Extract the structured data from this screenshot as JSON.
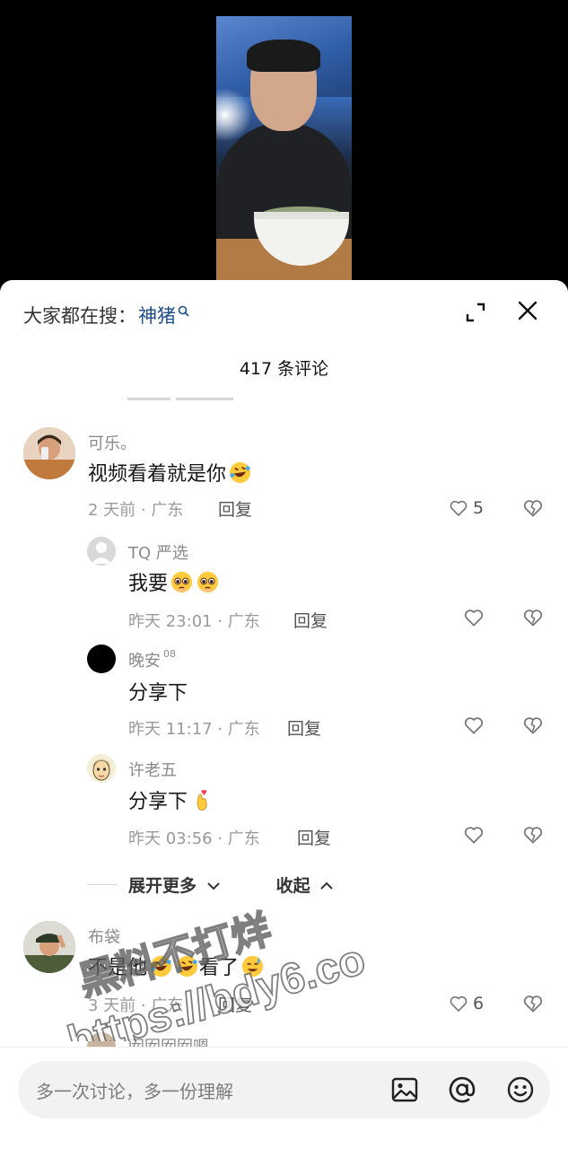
{
  "header": {
    "search_prefix": "大家都在搜：",
    "search_term": "神猪",
    "comment_count": "417 条评论"
  },
  "comments": [
    {
      "name": "可乐。",
      "text": "视频看着就是你",
      "meta": "2 天前 · 广东",
      "reply_label": "回复",
      "likes": "5",
      "emojis": [
        "rofl-emoji"
      ]
    },
    {
      "name": "TQ 严选",
      "text": "我要",
      "meta": "昨天 23:01 · 广东",
      "reply_label": "回复",
      "emojis": [
        "pleading-emoji",
        "pleading-emoji"
      ]
    },
    {
      "name": "晚安",
      "name_badge": "08",
      "text": "分享下",
      "meta": "昨天 11:17 · 广东",
      "reply_label": "回复",
      "emojis": []
    },
    {
      "name": "许老五",
      "text": "分享下",
      "meta": "昨天 03:56 · 广东",
      "reply_label": "回复",
      "emojis": [
        "finger-heart-emoji"
      ]
    },
    {
      "name": "布袋",
      "text_a": "不是他",
      "text_b": "看了",
      "meta": "3 天前 · 广东",
      "reply_label": "回复",
      "likes": "6",
      "emojis": [
        "rofl-emoji",
        "rofl-emoji",
        "sweat-emoji"
      ]
    }
  ],
  "replies_control": {
    "expand_label": "展开更多",
    "collapse_label": "收起"
  },
  "partial_next_name": "囡囡囡囡嗯",
  "watermark": {
    "line1": "黑料不打烊",
    "line2": "https://bdy6.co"
  },
  "input": {
    "placeholder": "多一次讨论，多一份理解"
  },
  "colors": {
    "link_blue": "#1f4e8c",
    "sheet_bg": "#ffffff",
    "input_bg": "#f2f2f3"
  }
}
